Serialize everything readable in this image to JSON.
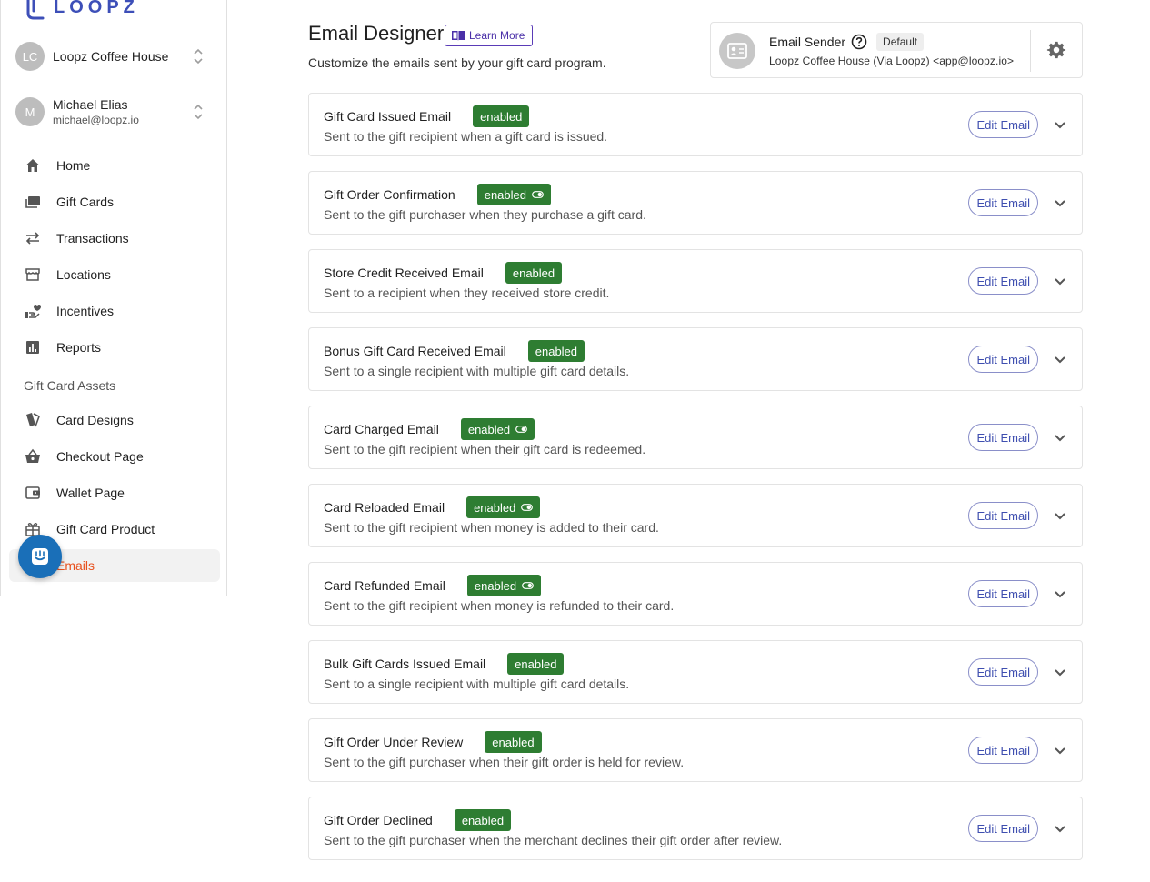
{
  "brand": {
    "logo_text": "LOOPZ"
  },
  "accounts": [
    {
      "initials": "LC",
      "name": "Loopz Coffee House",
      "sub": ""
    },
    {
      "initials": "M",
      "name": "Michael Elias",
      "sub": "michael@loopz.io"
    }
  ],
  "nav": {
    "items": [
      {
        "label": "Home",
        "icon": "home-icon"
      },
      {
        "label": "Gift Cards",
        "icon": "gift-cards-icon"
      },
      {
        "label": "Transactions",
        "icon": "swap-arrows-icon"
      },
      {
        "label": "Locations",
        "icon": "storefront-icon"
      },
      {
        "label": "Incentives",
        "icon": "volunteer-heart-icon"
      },
      {
        "label": "Reports",
        "icon": "bar-chart-icon"
      }
    ],
    "section_label": "Gift Card Assets",
    "asset_items": [
      {
        "label": "Card Designs",
        "icon": "cards-stack-icon"
      },
      {
        "label": "Checkout Page",
        "icon": "shopping-basket-icon"
      },
      {
        "label": "Wallet Page",
        "icon": "wallet-icon"
      },
      {
        "label": "Gift Card Product",
        "icon": "gift-icon"
      },
      {
        "label": "Emails",
        "icon": "email-icon",
        "active": true
      }
    ]
  },
  "header": {
    "title": "Email Designer",
    "learn_more": "Learn More",
    "subtitle": "Customize the emails sent by your gift card program."
  },
  "sender": {
    "title": "Email Sender",
    "default_chip": "Default",
    "address": "Loopz Coffee House (Via Loopz) <app@loopz.io>"
  },
  "emails": [
    {
      "title": "Gift Card Issued Email",
      "status": "enabled",
      "toggle": false,
      "description": "Sent to the gift recipient when a gift card is issued.",
      "edit_label": "Edit Email"
    },
    {
      "title": "Gift Order Confirmation",
      "status": "enabled",
      "toggle": true,
      "description": "Sent to the gift purchaser when they purchase a gift card.",
      "edit_label": "Edit Email"
    },
    {
      "title": "Store Credit Received Email",
      "status": "enabled",
      "toggle": false,
      "description": "Sent to a recipient when they received store credit.",
      "edit_label": "Edit Email"
    },
    {
      "title": "Bonus Gift Card Received Email",
      "status": "enabled",
      "toggle": false,
      "description": "Sent to a single recipient with multiple gift card details.",
      "edit_label": "Edit Email"
    },
    {
      "title": "Card Charged Email",
      "status": "enabled",
      "toggle": true,
      "description": "Sent to the gift recipient when their gift card is redeemed.",
      "edit_label": "Edit Email"
    },
    {
      "title": "Card Reloaded Email",
      "status": "enabled",
      "toggle": true,
      "description": "Sent to the gift recipient when money is added to their card.",
      "edit_label": "Edit Email"
    },
    {
      "title": "Card Refunded Email",
      "status": "enabled",
      "toggle": true,
      "description": "Sent to the gift recipient when money is refunded to their card.",
      "edit_label": "Edit Email"
    },
    {
      "title": "Bulk Gift Cards Issued Email",
      "status": "enabled",
      "toggle": false,
      "description": "Sent to a single recipient with multiple gift card details.",
      "edit_label": "Edit Email"
    },
    {
      "title": "Gift Order Under Review",
      "status": "enabled",
      "toggle": false,
      "description": "Sent to the gift purchaser when their gift order is held for review.",
      "edit_label": "Edit Email"
    },
    {
      "title": "Gift Order Declined",
      "status": "enabled",
      "toggle": false,
      "description": "Sent to the gift purchaser when the merchant declines their gift order after review.",
      "edit_label": "Edit Email"
    }
  ],
  "colors": {
    "accent": "#3f4fb0",
    "active_nav": "#e8501d",
    "badge_green": "#2e7d32",
    "learn_more": "#5a3bb7"
  }
}
